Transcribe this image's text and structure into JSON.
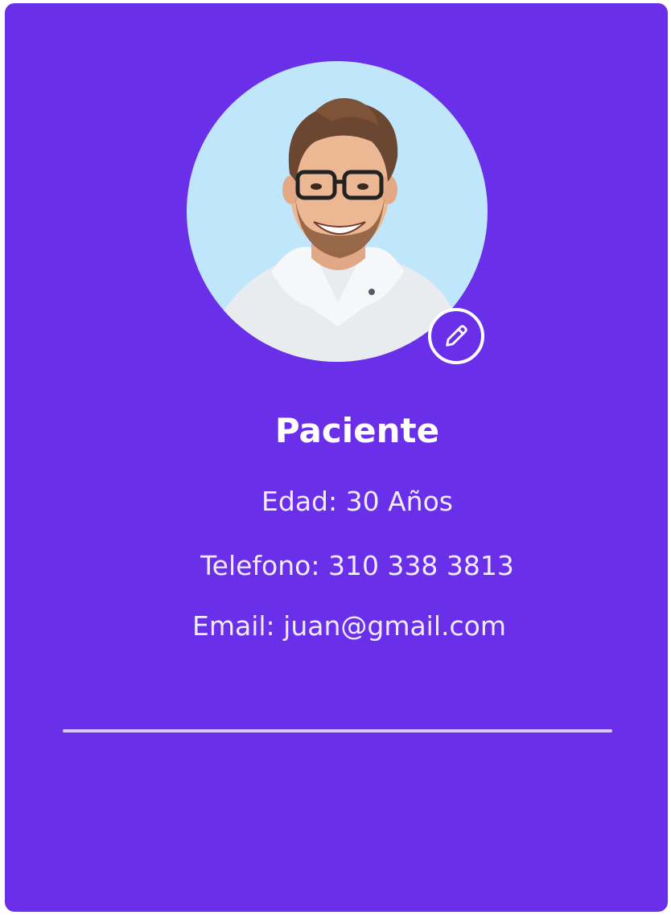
{
  "patient": {
    "name": "Paciente",
    "age_text": "Edad: 30 Años",
    "phone_text": "Telefono: 310 338 3813",
    "email_text": "Email: juan@gmail.com"
  },
  "icons": {
    "edit": "pencil-icon"
  },
  "colors": {
    "card_background": "#6a2fe9",
    "avatar_background": "#bfe6fb",
    "text": "#ffffff",
    "divider": "#d7caff"
  }
}
